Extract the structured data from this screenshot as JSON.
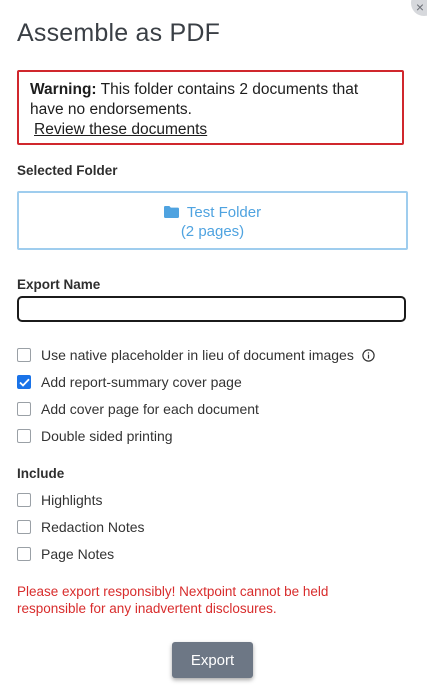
{
  "dialog": {
    "title": "Assemble as PDF",
    "close_glyph": "×"
  },
  "warning": {
    "strong": "Warning:",
    "message": " This folder contains 2 documents that have no endorsements.",
    "link": "Review these documents"
  },
  "selected_folder": {
    "label": "Selected Folder",
    "name": "Test Folder",
    "pages": "(2 pages)",
    "icon": "folder-icon"
  },
  "export_name": {
    "label": "Export Name",
    "value": "",
    "placeholder": ""
  },
  "options": [
    {
      "label": "Use native placeholder in lieu of document images",
      "checked": false,
      "info_icon": true
    },
    {
      "label": "Add report-summary cover page",
      "checked": true
    },
    {
      "label": "Add cover page for each document",
      "checked": false
    },
    {
      "label": "Double sided printing",
      "checked": false
    }
  ],
  "include": {
    "label": "Include",
    "items": [
      {
        "label": "Highlights",
        "checked": false
      },
      {
        "label": "Redaction Notes",
        "checked": false
      },
      {
        "label": "Page Notes",
        "checked": false
      }
    ]
  },
  "disclaimer": "Please export responsibly! Nextpoint cannot be held responsible for any inadvertent disclosures.",
  "export_button": "Export",
  "colors": {
    "accent": "#1a73e8",
    "warning_border": "#d0272d",
    "folder_border": "#9fcdee",
    "folder_text": "#4fa3e0",
    "disclaimer": "#d82c2c",
    "export_button_bg": "#6d7785"
  }
}
